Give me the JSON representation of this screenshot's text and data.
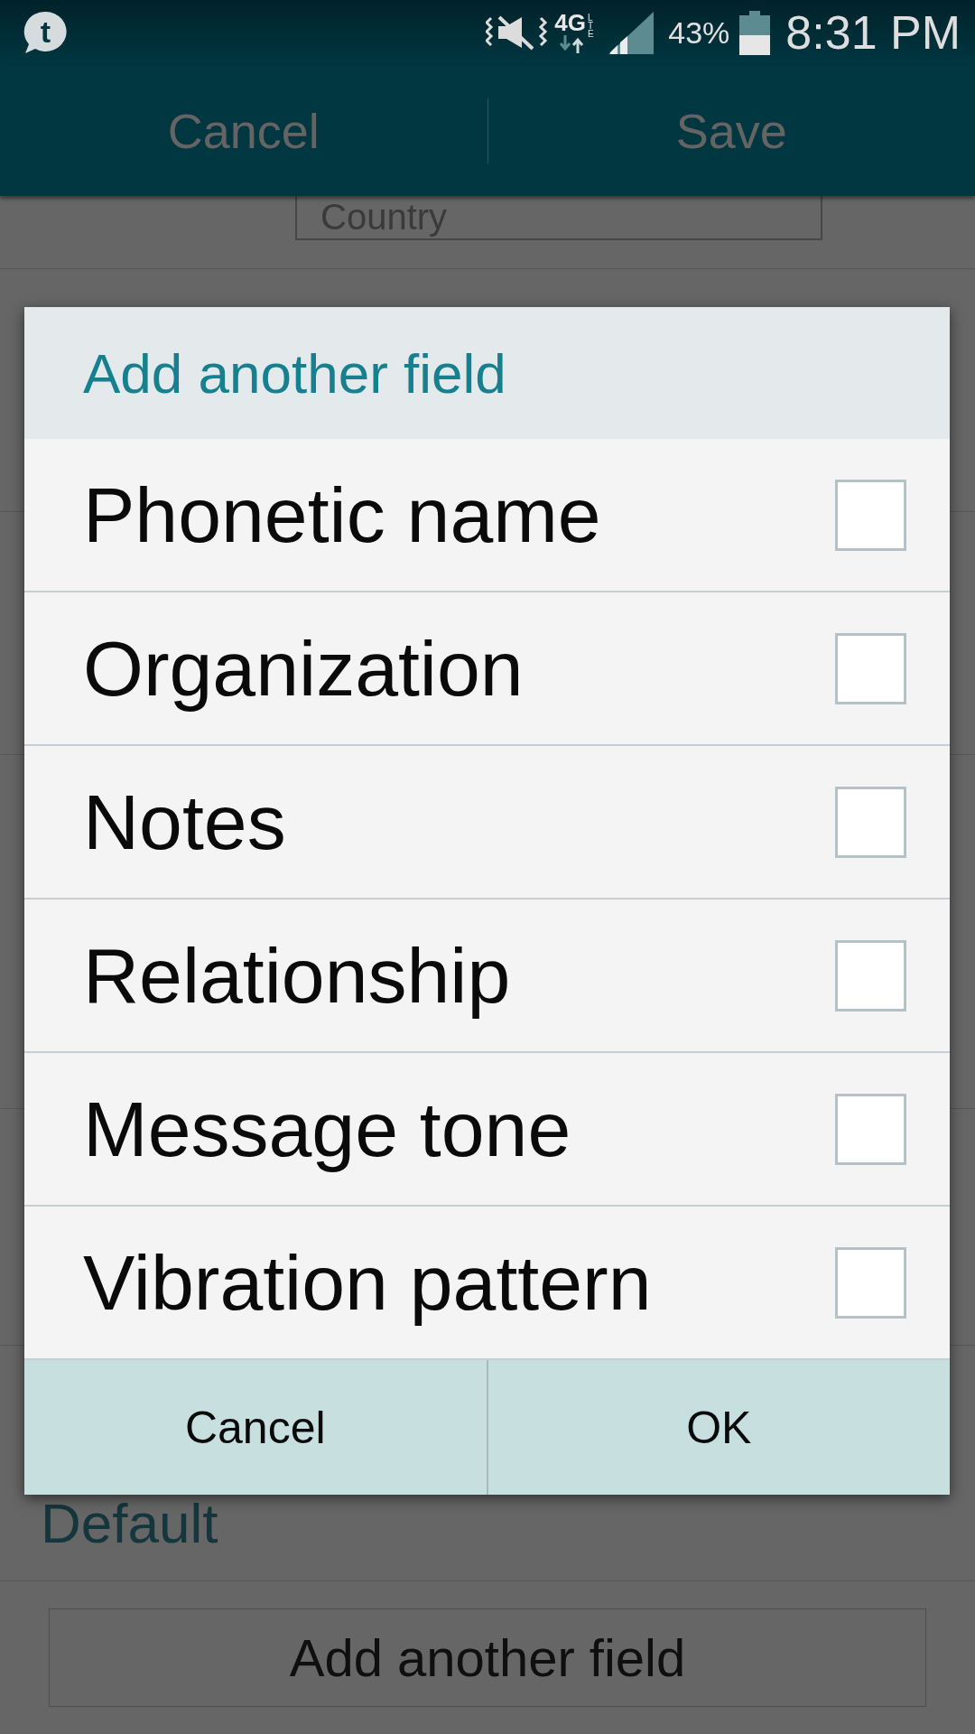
{
  "status_bar": {
    "app_icon_letter": "t",
    "network_type": "4G",
    "network_subtype": "LTE",
    "battery": "43%",
    "time": "8:31 PM"
  },
  "action_bar": {
    "buttons": [
      "Cancel",
      "Save"
    ]
  },
  "form": {
    "country_field": {
      "placeholder": "Country"
    },
    "field_value": "Default",
    "add_field_button": "Add another field"
  },
  "dialog": {
    "title": "Add another field",
    "options": [
      {
        "label": "Phonetic name",
        "checked": false
      },
      {
        "label": "Organization",
        "checked": false
      },
      {
        "label": "Notes",
        "checked": false
      },
      {
        "label": "Relationship",
        "checked": false
      },
      {
        "label": "Message tone",
        "checked": false
      },
      {
        "label": "Vibration pattern",
        "checked": false
      }
    ],
    "buttons": [
      "Cancel",
      "OK"
    ]
  }
}
